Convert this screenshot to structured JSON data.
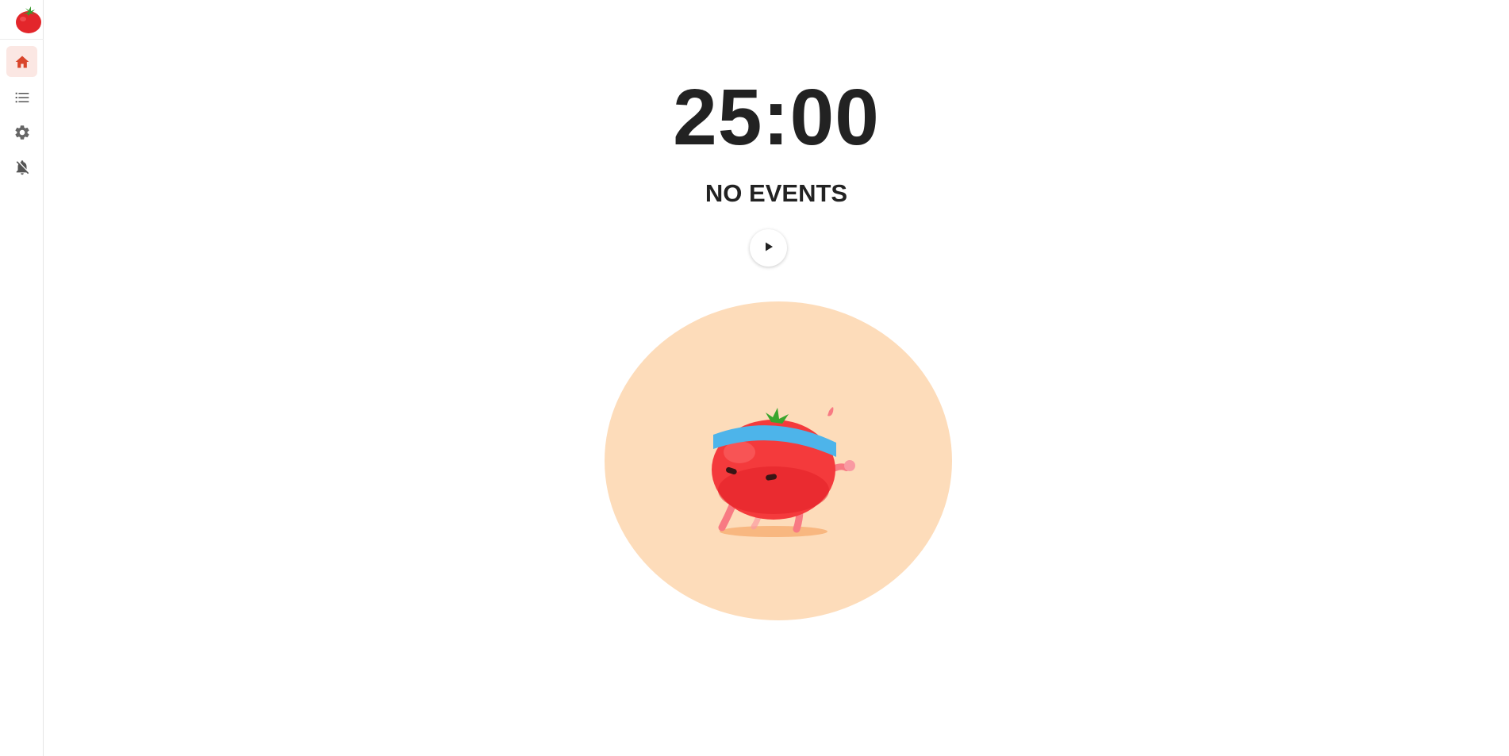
{
  "app": {
    "logo_icon": "tomato-logo-icon",
    "accent_color": "#d9452b",
    "active_bg_color": "#fbe7e3"
  },
  "sidebar": {
    "items": [
      {
        "name": "home",
        "icon": "home-icon",
        "active": true
      },
      {
        "name": "tasks",
        "icon": "list-icon",
        "active": false
      },
      {
        "name": "settings",
        "icon": "gear-icon",
        "active": false
      },
      {
        "name": "notifications",
        "icon": "bell-off-icon",
        "active": false
      }
    ]
  },
  "timer": {
    "display": "25:00"
  },
  "status": {
    "text": "NO EVENTS"
  },
  "controls": {
    "play_icon": "play-icon"
  },
  "mascot": {
    "icon": "running-tomato-icon",
    "circle_color": "#fddcba"
  }
}
